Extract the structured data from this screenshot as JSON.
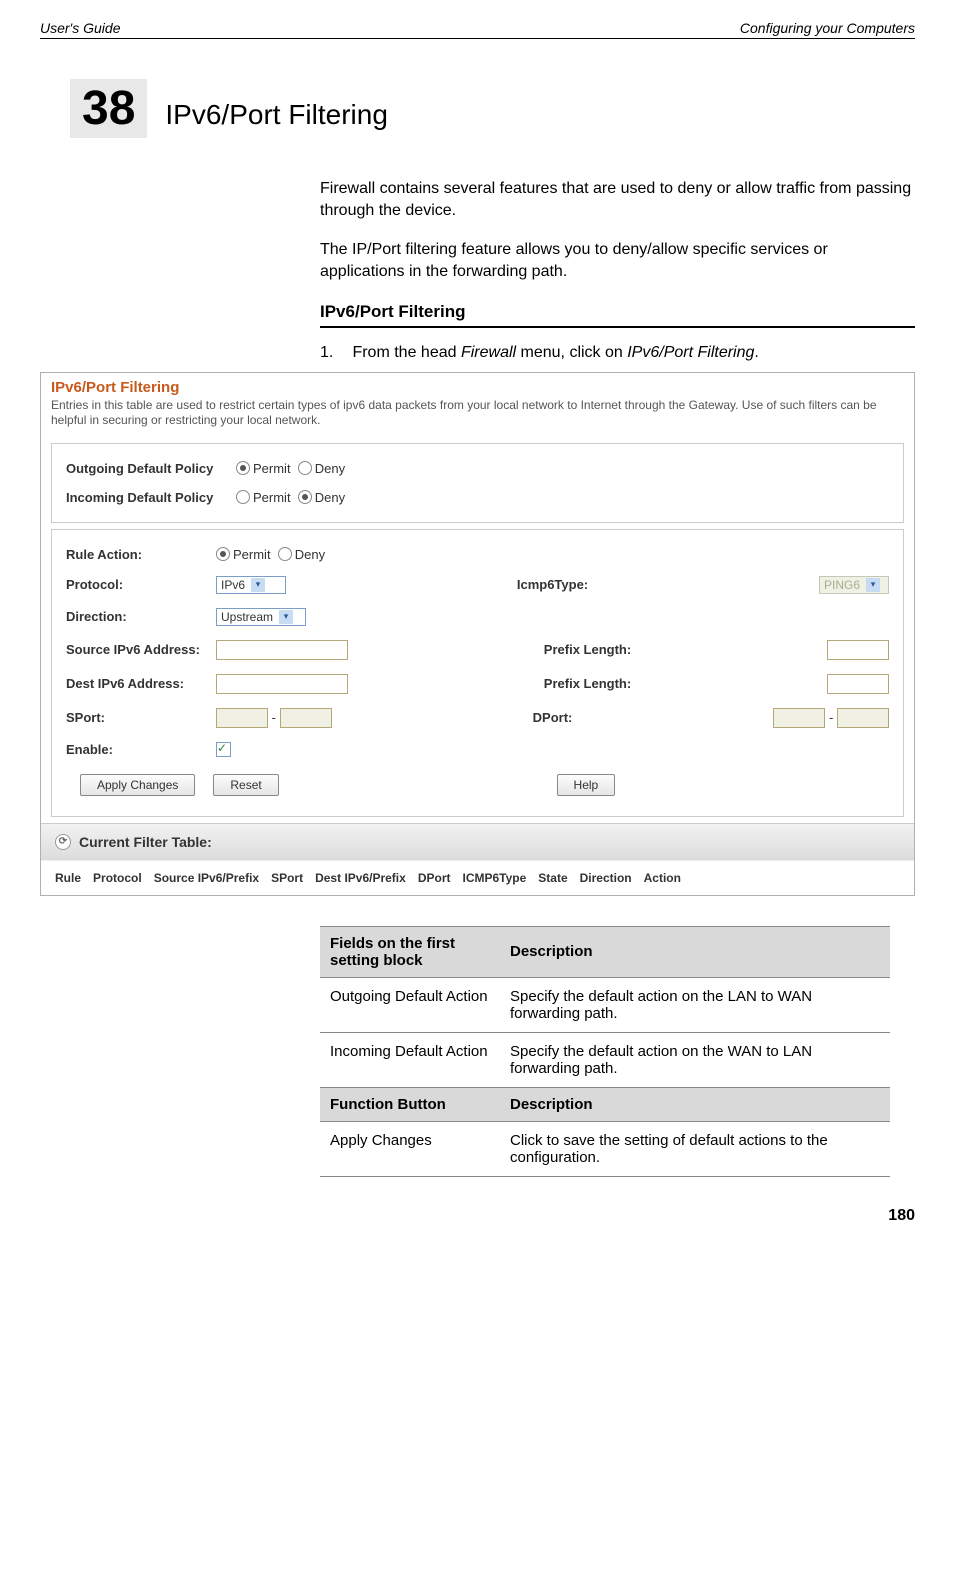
{
  "header": {
    "left": "User's Guide",
    "right": "Configuring your Computers"
  },
  "chapter": {
    "number": "38",
    "title": "IPv6/Port Filtering"
  },
  "paragraphs": {
    "p1": "Firewall contains several features that are used to deny or allow traffic from passing through the device.",
    "p2": "The IP/Port filtering feature allows you to deny/allow specific services or applications in the forwarding path."
  },
  "section_heading": "IPv6/Port Filtering",
  "step1": {
    "num": "1.",
    "before": "From the head ",
    "i1": "Firewall",
    "mid": " menu, click on ",
    "i2": "IPv6/Port Filtering",
    "after": "."
  },
  "ss": {
    "title": "IPv6/Port Filtering",
    "desc": "Entries in this table are used to restrict certain types of ipv6 data packets from your local network to Internet through the Gateway. Use of such filters can be helpful in securing or restricting your local network.",
    "outgoing_label": "Outgoing Default Policy",
    "incoming_label": "Incoming Default Policy",
    "permit": "Permit",
    "deny": "Deny",
    "rule_action": "Rule Action:",
    "protocol": "Protocol:",
    "protocol_val": "IPv6",
    "icmp6type": "Icmp6Type:",
    "icmp6_val": "PING6",
    "direction": "Direction:",
    "direction_val": "Upstream",
    "src_label": "Source IPv6 Address:",
    "dst_label": "Dest IPv6 Address:",
    "prefix": "Prefix Length:",
    "sport": "SPort:",
    "dport": "DPort:",
    "enable": "Enable:",
    "dash": "-",
    "btn_apply": "Apply Changes",
    "btn_reset": "Reset",
    "btn_help": "Help",
    "current_filter": "Current Filter Table:",
    "headers": {
      "rule": "Rule",
      "protocol": "Protocol",
      "src": "Source IPv6/Prefix",
      "sport": "SPort",
      "dst": "Dest IPv6/Prefix",
      "dport": "DPort",
      "icmp": "ICMP6Type",
      "state": "State",
      "direction": "Direction",
      "action": "Action"
    }
  },
  "table": {
    "h1a": "Fields on the first setting block",
    "h1b": "Description",
    "r1a": "Outgoing Default Action",
    "r1b": "Specify the default action on the LAN to WAN forwarding path.",
    "r2a": "Incoming Default Action",
    "r2b": "Specify the default action on the WAN to LAN forwarding path.",
    "h2a": "Function Button",
    "h2b": "Description",
    "r3a": "Apply Changes",
    "r3b": "Click to save the setting of default actions to the configuration."
  },
  "page_number": "180"
}
